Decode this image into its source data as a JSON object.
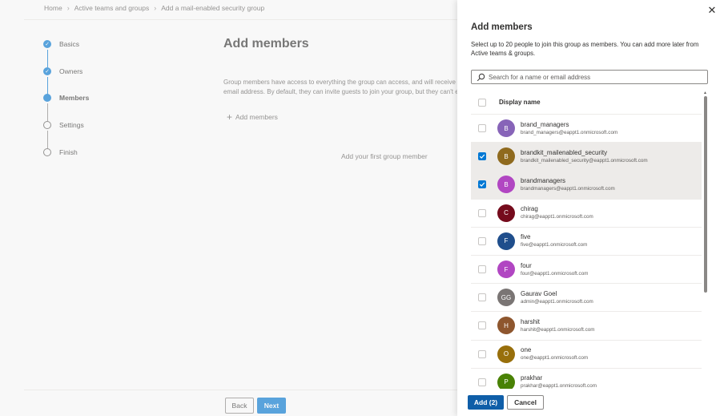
{
  "breadcrumb": {
    "items": [
      "Home",
      "Active teams and groups",
      "Add a mail-enabled security group"
    ]
  },
  "steps": [
    {
      "label": "Basics",
      "state": "done"
    },
    {
      "label": "Owners",
      "state": "done"
    },
    {
      "label": "Members",
      "state": "current"
    },
    {
      "label": "Settings",
      "state": "todo"
    },
    {
      "label": "Finish",
      "state": "todo"
    }
  ],
  "main": {
    "title": "Add members",
    "description_line1": "Group members have access to everything the group can access, and will receive em",
    "description_line2": "email address. By default, they can invite guests to join your group, but they can't ed",
    "add_members_label": "Add members",
    "empty_state": "Add your first group member",
    "back_label": "Back",
    "next_label": "Next"
  },
  "panel": {
    "title": "Add members",
    "description": "Select up to 20 people to join this group as members. You can add more later from Active teams & groups.",
    "search_placeholder": "Search for a name or email address",
    "column_header": "Display name",
    "add_label": "Add (2)",
    "cancel_label": "Cancel",
    "close_glyph": "✕"
  },
  "members": [
    {
      "initials": "B",
      "name": "brand_managers",
      "email": "brand_managers@eappt1.onmicrosoft.com",
      "color": "#8764b8",
      "selected": false
    },
    {
      "initials": "B",
      "name": "brandkit_mailenabled_security",
      "email": "brandkit_mailenabled_security@eappt1.onmicrosoft.com",
      "color": "#8f6a1e",
      "selected": true
    },
    {
      "initials": "B",
      "name": "brandmanagers",
      "email": "brandmanagers@eappt1.onmicrosoft.com",
      "color": "#b146c2",
      "selected": true
    },
    {
      "initials": "C",
      "name": "chirag",
      "email": "chirag@eappt1.onmicrosoft.com",
      "color": "#750b1c",
      "selected": false
    },
    {
      "initials": "F",
      "name": "five",
      "email": "five@eappt1.onmicrosoft.com",
      "color": "#1f4e8c",
      "selected": false
    },
    {
      "initials": "F",
      "name": "four",
      "email": "four@eappt1.onmicrosoft.com",
      "color": "#b146c2",
      "selected": false
    },
    {
      "initials": "GG",
      "name": "Gaurav Goel",
      "email": "admin@eappt1.onmicrosoft.com",
      "color": "#7a7574",
      "selected": false
    },
    {
      "initials": "H",
      "name": "harshit",
      "email": "harshit@eappt1.onmicrosoft.com",
      "color": "#8e562e",
      "selected": false
    },
    {
      "initials": "O",
      "name": "one",
      "email": "one@eappt1.onmicrosoft.com",
      "color": "#986f0b",
      "selected": false
    },
    {
      "initials": "P",
      "name": "prakhar",
      "email": "prakhar@eappt1.onmicrosoft.com",
      "color": "#498205",
      "selected": false
    }
  ]
}
